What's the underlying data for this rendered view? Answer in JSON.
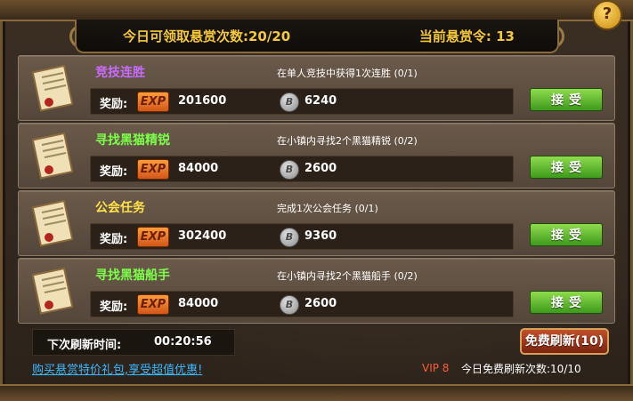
{
  "header": {
    "claims_today": "今日可领取悬赏次数:20/20",
    "current_tokens": "当前悬赏令: 13",
    "help": "?"
  },
  "quests": [
    {
      "title": "竞技连胜",
      "title_color": "#c76bff",
      "description": "在单人竞技中获得1次连胜 (0/1)",
      "reward_label": "奖励:",
      "exp_label": "EXP",
      "exp": "201600",
      "coin_symbol": "B",
      "coins": "6240",
      "accept": "接受"
    },
    {
      "title": "寻找黑猫精锐",
      "title_color": "#7cff4a",
      "description": "在小镇内寻找2个黑猫精锐 (0/2)",
      "reward_label": "奖励:",
      "exp_label": "EXP",
      "exp": "84000",
      "coin_symbol": "B",
      "coins": "2600",
      "accept": "接受"
    },
    {
      "title": "公会任务",
      "title_color": "#ffe24a",
      "description": "完成1次公会任务 (0/1)",
      "reward_label": "奖励:",
      "exp_label": "EXP",
      "exp": "302400",
      "coin_symbol": "B",
      "coins": "9360",
      "accept": "接受"
    },
    {
      "title": "寻找黑猫船手",
      "title_color": "#7cff4a",
      "description": "在小镇内寻找2个黑猫船手 (0/2)",
      "reward_label": "奖励:",
      "exp_label": "EXP",
      "exp": "84000",
      "coin_symbol": "B",
      "coins": "2600",
      "accept": "接受"
    }
  ],
  "footer": {
    "next_refresh_label": "下次刷新时间:",
    "next_refresh_time": "00:20:56",
    "free_refresh_button": "免费刷新(10)",
    "promo_link": "购买悬赏特价礼包,享受超值优惠!",
    "vip": "VIP 8",
    "free_refresh_count": "今日免费刷新次数:10/10"
  }
}
